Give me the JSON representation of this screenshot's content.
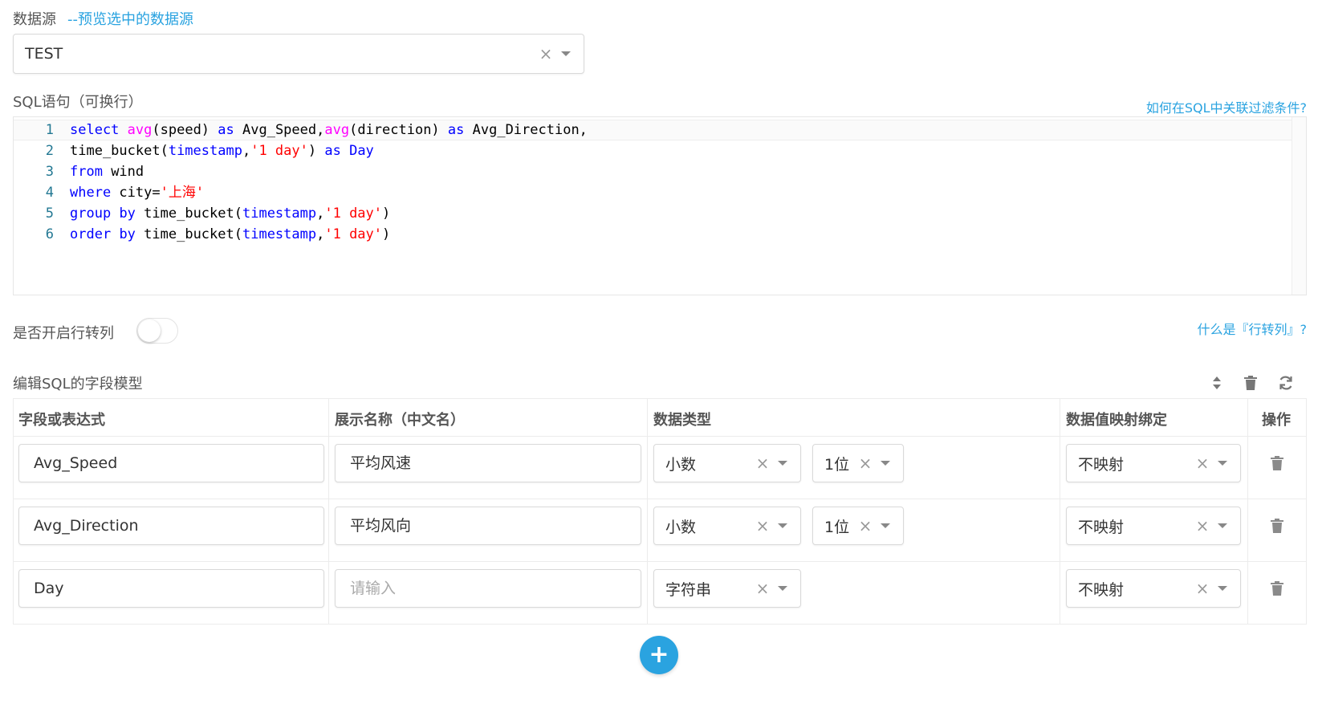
{
  "datasource": {
    "label": "数据源",
    "hint": "--预览选中的数据源",
    "value": "TEST",
    "clear_glyph": "×"
  },
  "sql": {
    "label": "SQL语句（可换行）",
    "help_link": "如何在SQL中关联过滤条件?",
    "lines": [
      {
        "num": "1",
        "tokens": [
          [
            "kw",
            "select"
          ],
          [
            "code",
            " "
          ],
          [
            "fn",
            "avg"
          ],
          [
            "code",
            "(speed) "
          ],
          [
            "kw",
            "as"
          ],
          [
            "code",
            " Avg_Speed,"
          ],
          [
            "fn",
            "avg"
          ],
          [
            "code",
            "(direction) "
          ],
          [
            "kw",
            "as"
          ],
          [
            "code",
            " Avg_Direction,"
          ]
        ]
      },
      {
        "num": "2",
        "tokens": [
          [
            "code",
            "time_bucket("
          ],
          [
            "kw",
            "timestamp"
          ],
          [
            "code",
            ","
          ],
          [
            "str",
            "'1 day'"
          ],
          [
            "code",
            ") "
          ],
          [
            "kw",
            "as"
          ],
          [
            "code",
            " "
          ],
          [
            "kw",
            "Day"
          ]
        ]
      },
      {
        "num": "3",
        "tokens": [
          [
            "kw",
            "from"
          ],
          [
            "code",
            " wind"
          ]
        ]
      },
      {
        "num": "4",
        "tokens": [
          [
            "kw",
            "where"
          ],
          [
            "code",
            " city="
          ],
          [
            "str",
            "'上海'"
          ]
        ]
      },
      {
        "num": "5",
        "tokens": [
          [
            "kw",
            "group"
          ],
          [
            "code",
            " "
          ],
          [
            "kw",
            "by"
          ],
          [
            "code",
            " time_bucket("
          ],
          [
            "kw",
            "timestamp"
          ],
          [
            "code",
            ","
          ],
          [
            "str",
            "'1 day'"
          ],
          [
            "code",
            ")"
          ]
        ]
      },
      {
        "num": "6",
        "tokens": [
          [
            "kw",
            "order"
          ],
          [
            "code",
            " "
          ],
          [
            "kw",
            "by"
          ],
          [
            "code",
            " time_bucket("
          ],
          [
            "kw",
            "timestamp"
          ],
          [
            "code",
            ","
          ],
          [
            "str",
            "'1 day'"
          ],
          [
            "code",
            ")"
          ]
        ]
      }
    ]
  },
  "pivot": {
    "label": "是否开启行转列",
    "enabled": false,
    "help_link": "什么是『行转列』?"
  },
  "field_model": {
    "label": "编辑SQL的字段模型",
    "toolbar_icons": [
      "sort-icon",
      "trash-icon",
      "refresh-icon"
    ],
    "columns": [
      "字段或表达式",
      "展示名称（中文名）",
      "数据类型",
      "数据值映射绑定",
      "操作"
    ],
    "rows": [
      {
        "field": "Avg_Speed",
        "display": "平均风速",
        "display_placeholder": "",
        "type": "小数",
        "precision": "1位",
        "mapping": "不映射"
      },
      {
        "field": "Avg_Direction",
        "display": "平均风向",
        "display_placeholder": "",
        "type": "小数",
        "precision": "1位",
        "mapping": "不映射"
      },
      {
        "field": "Day",
        "display": "",
        "display_placeholder": "请输入",
        "type": "字符串",
        "precision": "",
        "mapping": "不映射"
      }
    ],
    "add_button": "+",
    "accent_color": "#2aa3e0"
  }
}
